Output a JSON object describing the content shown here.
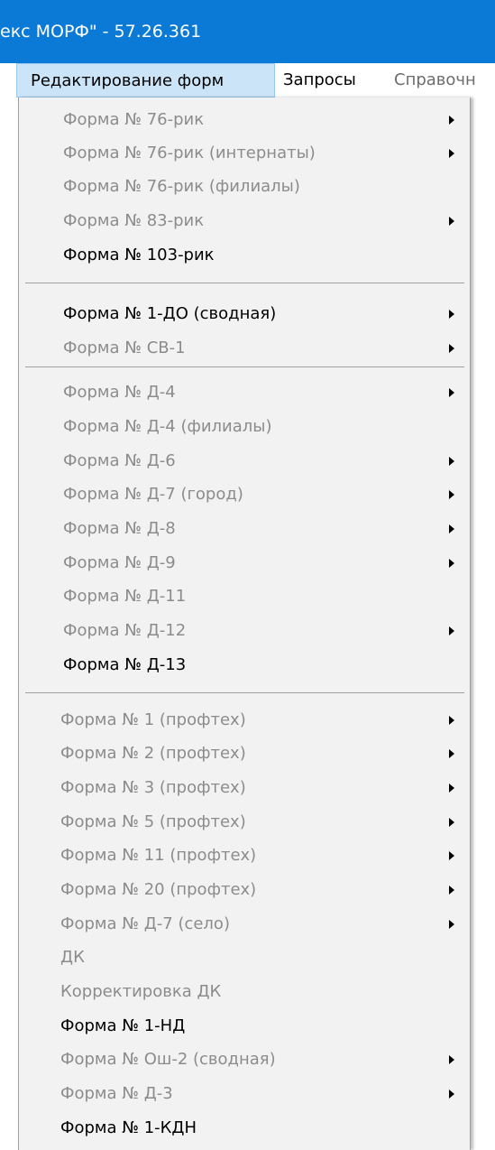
{
  "window": {
    "title": "екс МОРФ\" - 57.26.361"
  },
  "menubar": {
    "items": [
      {
        "label": "Редактирование форм"
      },
      {
        "label": "Запросы"
      },
      {
        "label": "Справочн"
      }
    ]
  },
  "menu": {
    "items": [
      {
        "label": "Форма № 76-рик",
        "enabled": false,
        "submenu": true
      },
      {
        "label": "Форма № 76-рик (интернаты)",
        "enabled": false,
        "submenu": true
      },
      {
        "label": "Форма № 76-рик (филиалы)",
        "enabled": false,
        "submenu": false
      },
      {
        "label": "Форма № 83-рик",
        "enabled": false,
        "submenu": true
      },
      {
        "label": "Форма № 103-рик",
        "enabled": true,
        "submenu": false
      },
      {
        "label": "Форма № 1-ДО (сводная)",
        "enabled": true,
        "submenu": true
      },
      {
        "label": "Форма № СВ-1",
        "enabled": false,
        "submenu": true
      },
      {
        "label": "Форма № Д-4",
        "enabled": false,
        "submenu": true
      },
      {
        "label": "Форма № Д-4 (филиалы)",
        "enabled": false,
        "submenu": false
      },
      {
        "label": "Форма № Д-6",
        "enabled": false,
        "submenu": true
      },
      {
        "label": "Форма № Д-7 (город)",
        "enabled": false,
        "submenu": true
      },
      {
        "label": "Форма № Д-8",
        "enabled": false,
        "submenu": true
      },
      {
        "label": "Форма № Д-9",
        "enabled": false,
        "submenu": true
      },
      {
        "label": "Форма № Д-11",
        "enabled": false,
        "submenu": false
      },
      {
        "label": "Форма № Д-12",
        "enabled": false,
        "submenu": true
      },
      {
        "label": "Форма № Д-13",
        "enabled": true,
        "submenu": false
      },
      {
        "label": "Форма № 1 (профтех)",
        "enabled": false,
        "submenu": true
      },
      {
        "label": "Форма № 2 (профтех)",
        "enabled": false,
        "submenu": true
      },
      {
        "label": "Форма № 3 (профтех)",
        "enabled": false,
        "submenu": true
      },
      {
        "label": "Форма № 5 (профтех)",
        "enabled": false,
        "submenu": true
      },
      {
        "label": "Форма № 11 (профтех)",
        "enabled": false,
        "submenu": true
      },
      {
        "label": "Форма № 20 (профтех)",
        "enabled": false,
        "submenu": true
      },
      {
        "label": "Форма № Д-7 (село)",
        "enabled": false,
        "submenu": true
      },
      {
        "label": "ДК",
        "enabled": false,
        "submenu": false
      },
      {
        "label": "Корректировка ДК",
        "enabled": false,
        "submenu": false
      },
      {
        "label": "Форма № 1-НД",
        "enabled": true,
        "submenu": false
      },
      {
        "label": "Форма № Ош-2 (сводная)",
        "enabled": false,
        "submenu": true
      },
      {
        "label": "Форма № Д-3",
        "enabled": false,
        "submenu": true
      },
      {
        "label": "Форма № 1-КДН",
        "enabled": true,
        "submenu": false
      }
    ]
  },
  "colors": {
    "titlebar": "#0a7ad6",
    "menu_background": "#f2f2f2",
    "disabled_text": "#8c8c8c",
    "active_menubar_item": "#cce4f7"
  }
}
